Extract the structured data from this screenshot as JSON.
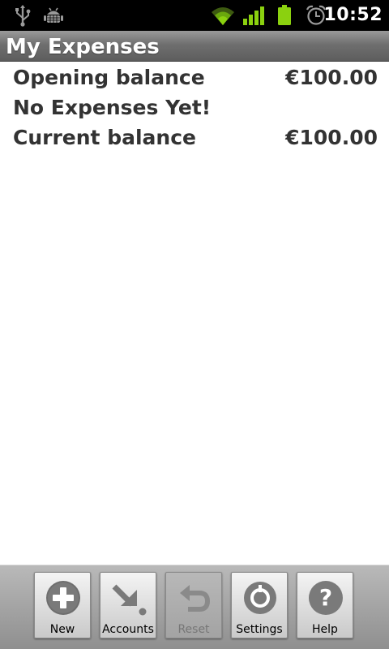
{
  "status_bar": {
    "time": "10:52",
    "icons": [
      "usb-icon",
      "android-debug-icon",
      "wifi-icon",
      "signal-icon",
      "battery-icon",
      "alarm-icon"
    ],
    "accent_color": "#8bd10f"
  },
  "title_bar": {
    "title": "My Expenses"
  },
  "summary": {
    "opening_label": "Opening balance",
    "opening_value": "€100.00",
    "empty_message": "No Expenses Yet!",
    "current_label": "Current balance",
    "current_value": "€100.00"
  },
  "menu": {
    "items": [
      {
        "label": "New",
        "icon": "plus-icon",
        "enabled": true
      },
      {
        "label": "Accounts",
        "icon": "accounts-arrow-icon",
        "enabled": true
      },
      {
        "label": "Reset",
        "icon": "undo-icon",
        "enabled": false
      },
      {
        "label": "Settings",
        "icon": "gear-icon",
        "enabled": true
      },
      {
        "label": "Help",
        "icon": "help-icon",
        "enabled": true
      }
    ]
  }
}
